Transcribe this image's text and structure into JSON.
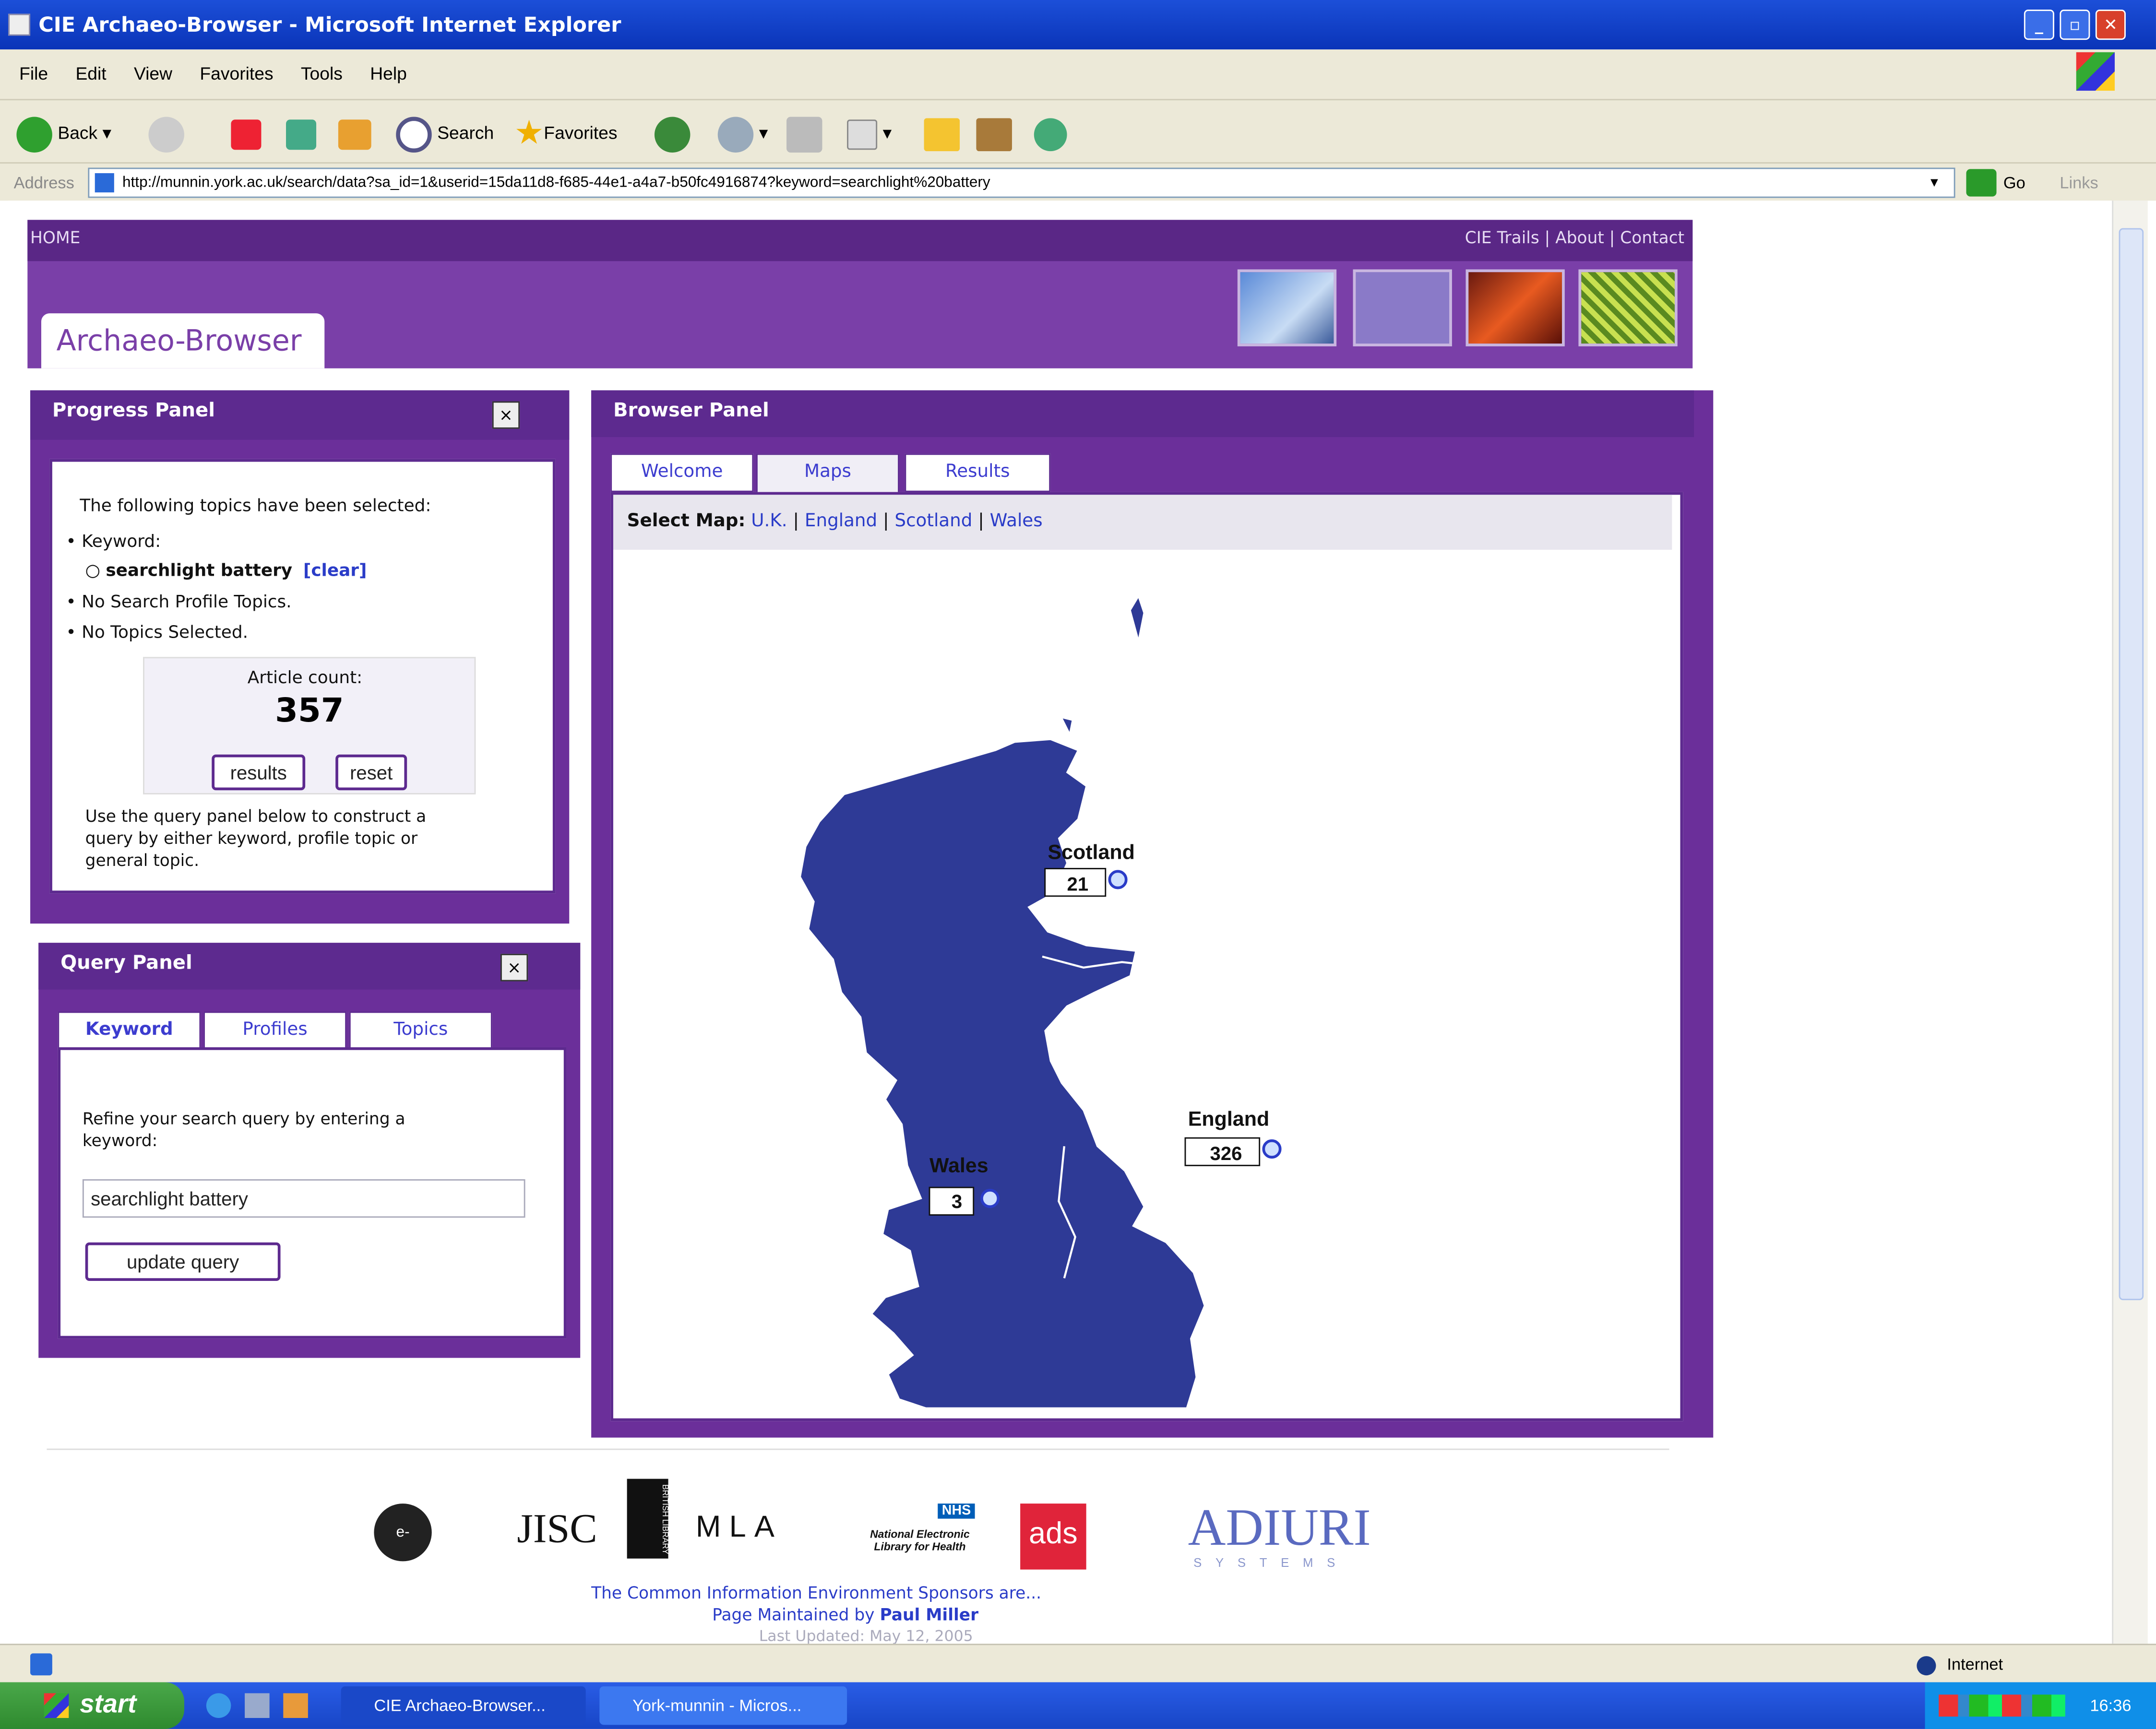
{
  "window": {
    "title": "CIE Archaeo-Browser - Microsoft Internet Explorer",
    "controls": {
      "minimize": "_",
      "maximize": "▫",
      "close": "✕"
    }
  },
  "menu": [
    "File",
    "Edit",
    "View",
    "Favorites",
    "Tools",
    "Help"
  ],
  "toolbar": {
    "back": "Back",
    "search": "Search",
    "favorites": "Favorites"
  },
  "address": {
    "label": "Address",
    "url": "http://munnin.york.ac.uk/search/data?sa_id=1&userid=15da11d8-f685-44e1-a4a7-b50fc4916874?keyword=searchlight%20battery",
    "go": "Go",
    "links": "Links"
  },
  "site": {
    "nav_home": "HOME",
    "nav_right": "CIE Trails | About | Contact",
    "brand": "Archaeo-Browser"
  },
  "progress": {
    "title": "Progress Panel",
    "close": "×",
    "intro": "The following topics have been selected:",
    "keyword_label": "Keyword:",
    "keyword_value": "searchlight battery",
    "clear": "[clear]",
    "no_profile": "No Search Profile Topics.",
    "no_topics": "No Topics Selected.",
    "count_label": "Article count:",
    "count": "357",
    "results_btn": "results",
    "reset_btn": "reset",
    "help_line1": "Use the query panel below to construct a",
    "help_line2": "query by either keyword, profile topic or",
    "help_line3": "general topic."
  },
  "query": {
    "title": "Query Panel",
    "close": "×",
    "tabs": [
      "Keyword",
      "Profiles",
      "Topics"
    ],
    "hint_line1": "Refine your search query by entering a",
    "hint_line2": "keyword:",
    "input_value": "searchlight battery",
    "update_btn": "update query"
  },
  "browser": {
    "title": "Browser Panel",
    "tabs": [
      "Welcome",
      "Maps",
      "Results"
    ],
    "select_map_label": "Select Map:",
    "maps": [
      "U.K.",
      "England",
      "Scotland",
      "Wales"
    ],
    "regions": [
      {
        "name": "Scotland",
        "count": "21"
      },
      {
        "name": "England",
        "count": "326"
      },
      {
        "name": "Wales",
        "count": "3"
      }
    ]
  },
  "footer": {
    "logos": [
      "e-Science",
      "JISC",
      "BRITISH LIBRARY",
      "MLA",
      "NHS",
      "National Electronic Library for Health",
      "ads",
      "ADIURI",
      "SYSTEMS"
    ],
    "sponsors": "The Common Information Environment Sponsors are...",
    "maintained_prefix": "Page Maintained by",
    "maintained_by": "Paul Miller",
    "updated": "Last Updated: May 12, 2005"
  },
  "status": {
    "zone": "Internet"
  },
  "taskbar": {
    "start": "start",
    "tasks": [
      "CIE Archaeo-Browser...",
      "York-munnin - Micros..."
    ],
    "clock": "16:36"
  },
  "colors": {
    "panel_purple": "#5d2a8f",
    "header_purple": "#7a3fa8",
    "map_blue": "#2e3a96",
    "link_blue": "#2a3cc8",
    "xp_blue": "#0a34b8"
  }
}
